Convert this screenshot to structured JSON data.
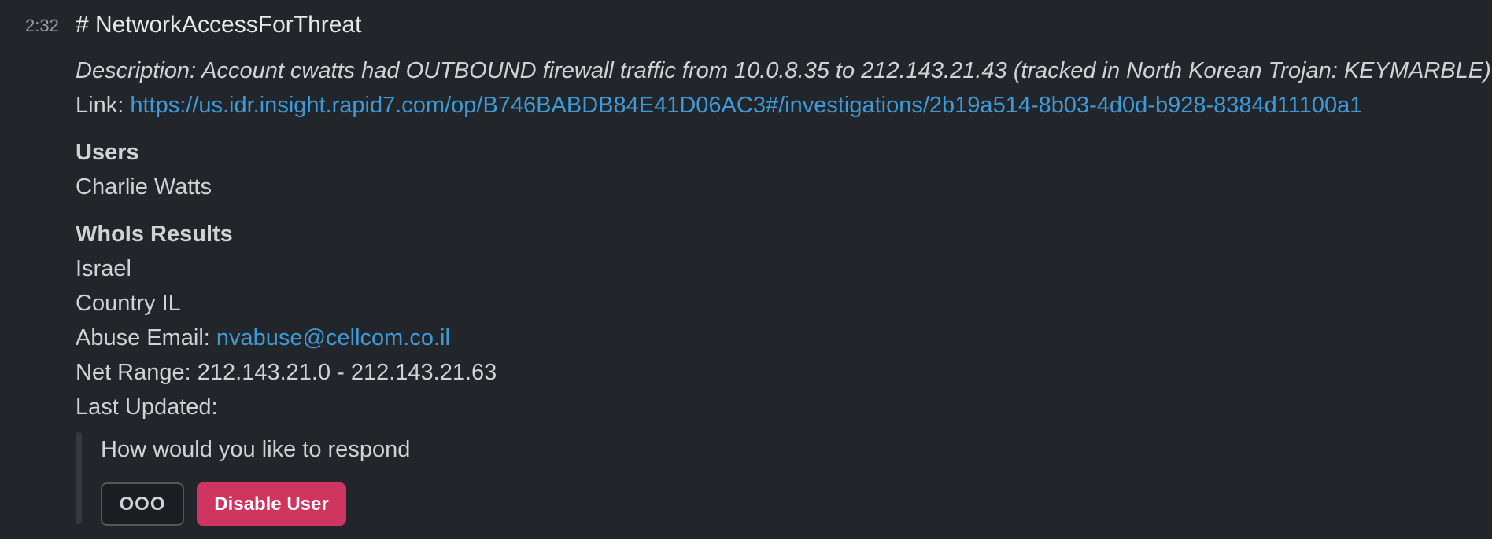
{
  "message": {
    "timestamp": "2:32",
    "channel_title": "# NetworkAccessForThreat",
    "description": "Description: Account cwatts had OUTBOUND firewall traffic from 10.0.8.35 to 212.143.21.43 (tracked in North Korean Trojan: KEYMARBLE)",
    "link_label": "Link: ",
    "link_url": "https://us.idr.insight.rapid7.com/op/B746BABDB84E41D06AC3#/investigations/2b19a514-8b03-4d0d-b928-8384d11100a1"
  },
  "users": {
    "heading": "Users",
    "items": [
      "Charlie Watts"
    ]
  },
  "whois": {
    "heading": "WhoIs Results",
    "country_name": "Israel",
    "country_code_line": "Country IL",
    "abuse_label": "Abuse Email: ",
    "abuse_email": "nvabuse@cellcom.co.il",
    "net_range": "Net Range: 212.143.21.0 - 212.143.21.63",
    "last_updated": "Last Updated:"
  },
  "attachment": {
    "prompt": "How would you like to respond",
    "buttons": {
      "option_label": "OOO",
      "disable_label": "Disable User"
    }
  },
  "colors": {
    "background": "#222529",
    "link": "#3e9ad6",
    "danger": "#d0355f"
  }
}
